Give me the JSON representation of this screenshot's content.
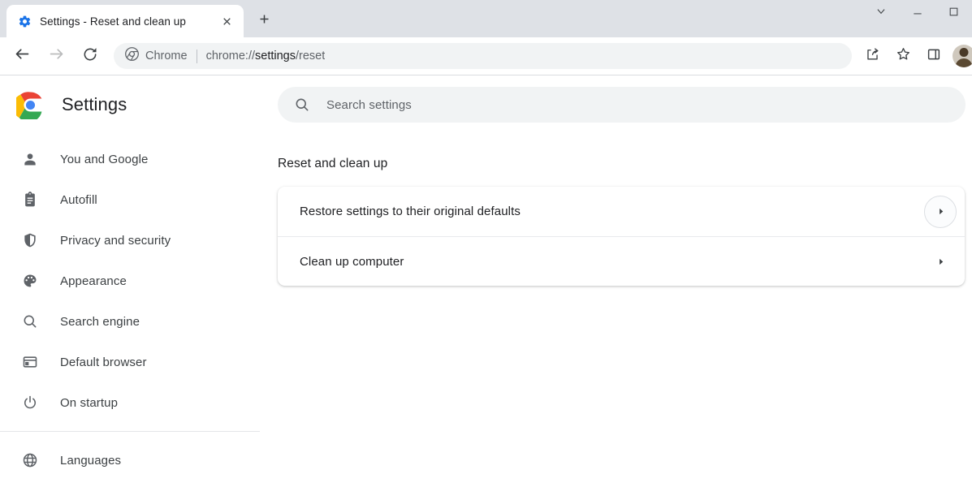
{
  "window": {
    "tab": {
      "title": "Settings - Reset and clean up",
      "favicon_icon": "gear-icon",
      "close_icon": "close-icon"
    },
    "new_tab_icon": "plus-icon",
    "controls": {
      "tab_search_icon": "chevron-down-icon",
      "minimize_icon": "minimize-icon",
      "maximize_icon": "maximize-icon"
    }
  },
  "toolbar": {
    "back_icon": "back-arrow-icon",
    "forward_icon": "forward-arrow-icon",
    "reload_icon": "reload-icon",
    "omnibox": {
      "chip_icon": "chrome-logo-icon",
      "chip_label": "Chrome",
      "url_scheme": "chrome://",
      "url_path_strong": "settings",
      "url_path_rest": "/reset"
    },
    "share_icon": "share-icon",
    "bookmark_icon": "star-icon",
    "side_panel_icon": "side-panel-icon",
    "avatar_icon": "profile-avatar"
  },
  "sidebar": {
    "brand_logo_icon": "chrome-logo-icon",
    "brand_title": "Settings",
    "items": [
      {
        "label": "You and Google",
        "icon": "person-icon"
      },
      {
        "label": "Autofill",
        "icon": "clipboard-icon"
      },
      {
        "label": "Privacy and security",
        "icon": "shield-icon"
      },
      {
        "label": "Appearance",
        "icon": "palette-icon"
      },
      {
        "label": "Search engine",
        "icon": "search-icon"
      },
      {
        "label": "Default browser",
        "icon": "browser-window-icon"
      },
      {
        "label": "On startup",
        "icon": "power-icon"
      }
    ],
    "items_after_divider": [
      {
        "label": "Languages",
        "icon": "globe-icon"
      }
    ]
  },
  "main": {
    "search": {
      "placeholder": "Search settings",
      "value": "",
      "icon": "search-icon"
    },
    "section_title": "Reset and clean up",
    "rows": [
      {
        "label": "Restore settings to their original defaults",
        "arrow_icon": "chevron-right-icon",
        "focused": true
      },
      {
        "label": "Clean up computer",
        "arrow_icon": "chevron-right-icon",
        "focused": false
      }
    ]
  },
  "colors": {
    "tabstrip_bg": "#dee1e6",
    "omnibox_bg": "#f1f3f4",
    "text_primary": "#202124",
    "text_secondary": "#5f6368",
    "divider": "#e8eaed"
  }
}
